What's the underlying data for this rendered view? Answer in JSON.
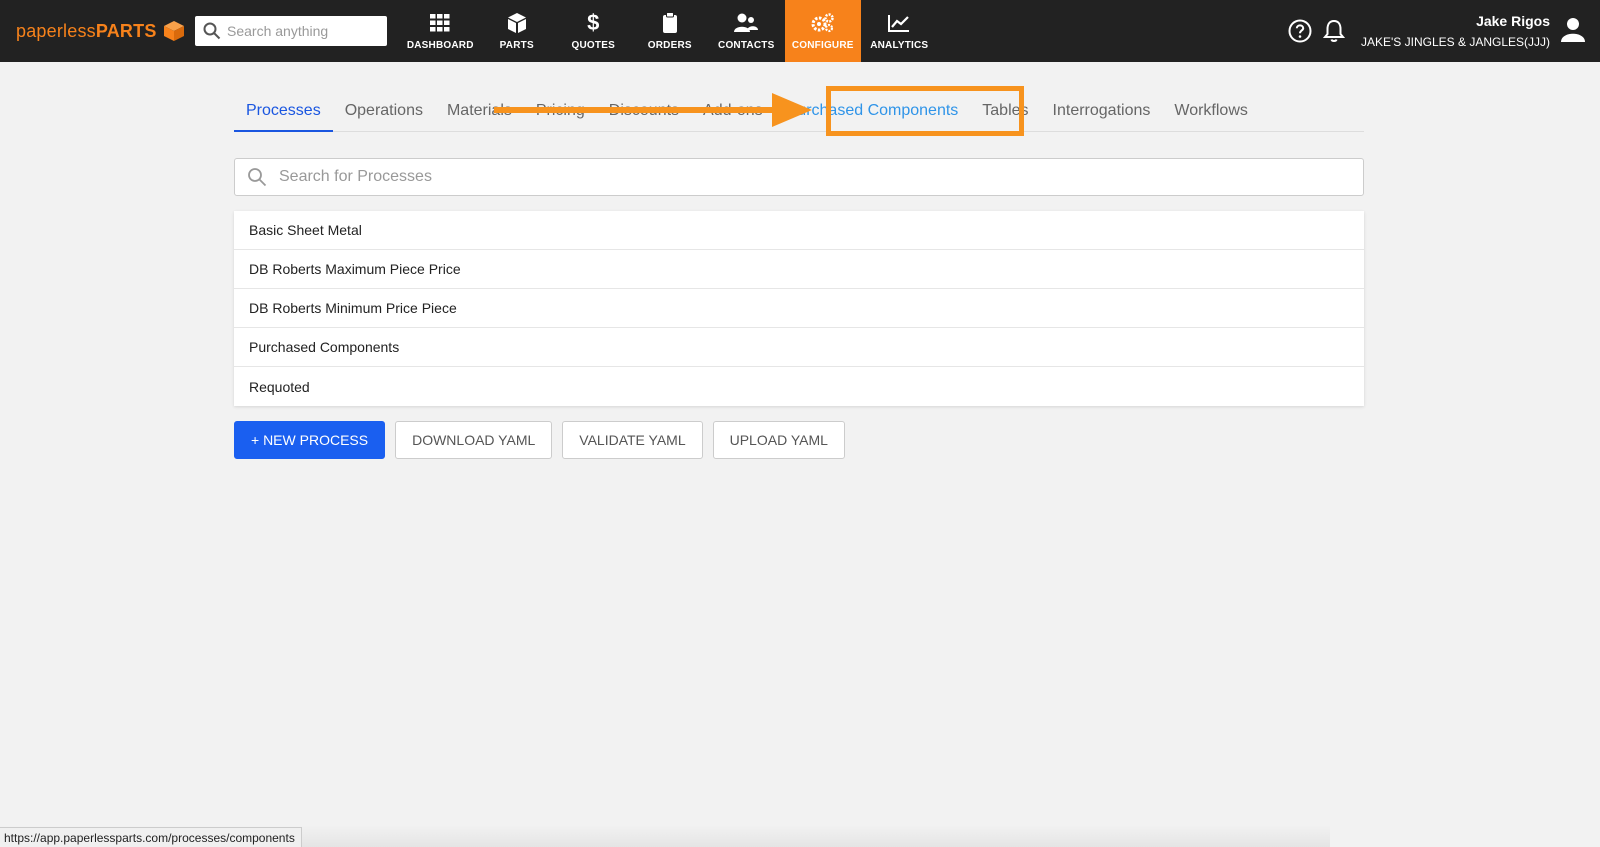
{
  "brand": {
    "part1": "paperless",
    "part2": "PARTS",
    "color": "#f7821b"
  },
  "global_search": {
    "placeholder": "Search anything"
  },
  "nav": [
    {
      "label": "DASHBOARD",
      "icon": "grid-icon"
    },
    {
      "label": "PARTS",
      "icon": "cube-icon"
    },
    {
      "label": "QUOTES",
      "icon": "dollar-icon"
    },
    {
      "label": "ORDERS",
      "icon": "clipboard-icon"
    },
    {
      "label": "CONTACTS",
      "icon": "contacts-icon"
    },
    {
      "label": "CONFIGURE",
      "icon": "gears-icon",
      "active": true
    },
    {
      "label": "ANALYTICS",
      "icon": "chart-icon"
    }
  ],
  "user": {
    "name": "Jake Rigos",
    "org": "JAKE'S JINGLES & JANGLES(JJJ)"
  },
  "tabs": [
    {
      "label": "Processes",
      "active": true
    },
    {
      "label": "Operations"
    },
    {
      "label": "Materials"
    },
    {
      "label": "Pricing"
    },
    {
      "label": "Discounts"
    },
    {
      "label": "Add-ons"
    },
    {
      "label": "Purchased Components",
      "highlighted": true
    },
    {
      "label": "Tables"
    },
    {
      "label": "Interrogations"
    },
    {
      "label": "Workflows"
    }
  ],
  "process_search": {
    "placeholder": "Search for Processes"
  },
  "processes": [
    "Basic Sheet Metal",
    "DB Roberts Maximum Piece Price",
    "DB Roberts Minimum Price Piece",
    "Purchased Components",
    "Requoted"
  ],
  "buttons": {
    "new_process": "+ NEW PROCESS",
    "download_yaml": "DOWNLOAD YAML",
    "validate_yaml": "VALIDATE YAML",
    "upload_yaml": "UPLOAD YAML"
  },
  "status_url": "https://app.paperlessparts.com/processes/components",
  "colors": {
    "topbar": "#222222",
    "accent": "#f7821b",
    "primary": "#1a5ff0",
    "annotation": "#f7931e"
  }
}
